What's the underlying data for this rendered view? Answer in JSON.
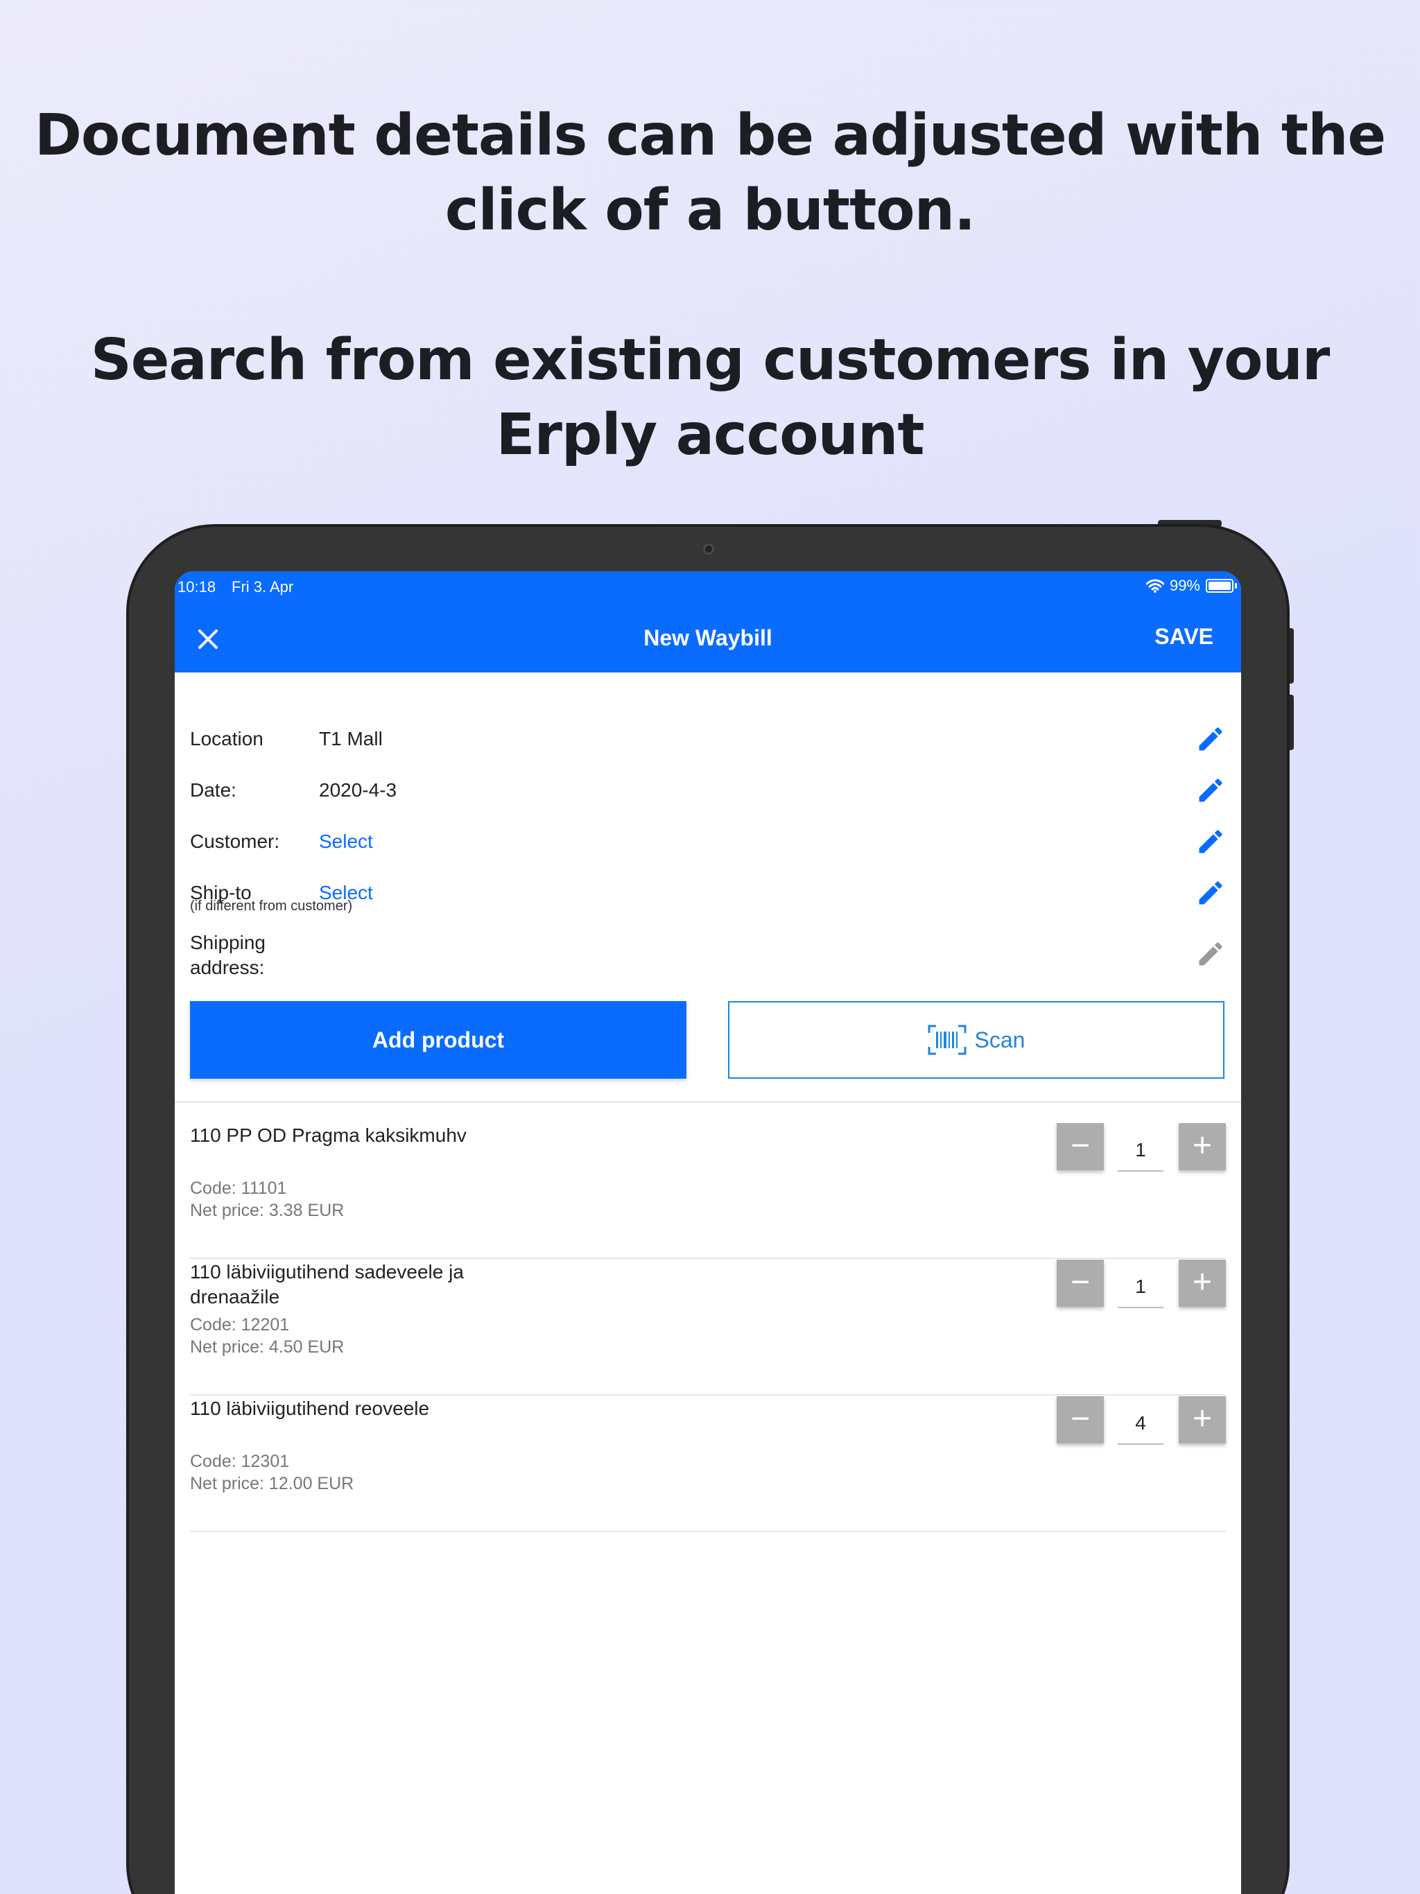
{
  "promo": {
    "headline_1": [
      "Document details can be adjusted with the",
      "click of a button."
    ],
    "headline_2": [
      "Search from existing customers in your",
      "Erply account"
    ]
  },
  "status_bar": {
    "time": "10:18",
    "date": "Fri 3. Apr",
    "battery": "99%"
  },
  "app_bar": {
    "title": "New Waybill",
    "save_label": "SAVE"
  },
  "fields": {
    "location": {
      "label": "Location",
      "value": "T1 Mall"
    },
    "date": {
      "label": "Date:",
      "value": "2020-4-3"
    },
    "customer": {
      "label": "Customer:",
      "value": "Select"
    },
    "ship_to": {
      "label": "Ship-to",
      "value": "Select",
      "hint": "(if different from customer)"
    },
    "shipping_address": {
      "label": "Shipping address:"
    }
  },
  "actions": {
    "add_product": "Add product",
    "scan": "Scan"
  },
  "products": [
    {
      "name": "110 PP OD Pragma kaksikmuhv",
      "code": "Code: 11101",
      "price": "Net price: 3.38 EUR",
      "qty": "1"
    },
    {
      "name": "110 läbiviigutihend sadeveele ja drenaažile",
      "code": "Code: 12201",
      "price": "Net price: 4.50 EUR",
      "qty": "1"
    },
    {
      "name": "110 läbiviigutihend reoveele",
      "code": "Code: 12301",
      "price": "Net price: 12.00 EUR",
      "qty": "4"
    }
  ],
  "icons": {
    "close": "close-icon",
    "edit": "pencil-icon",
    "scan": "barcode-icon",
    "wifi": "wifi-icon",
    "battery": "battery-icon"
  },
  "colors": {
    "primary": "#0a6cff",
    "scan_outline": "#1f86e0",
    "stepper": "#adadad",
    "edit_disabled": "#9a9a9a"
  }
}
